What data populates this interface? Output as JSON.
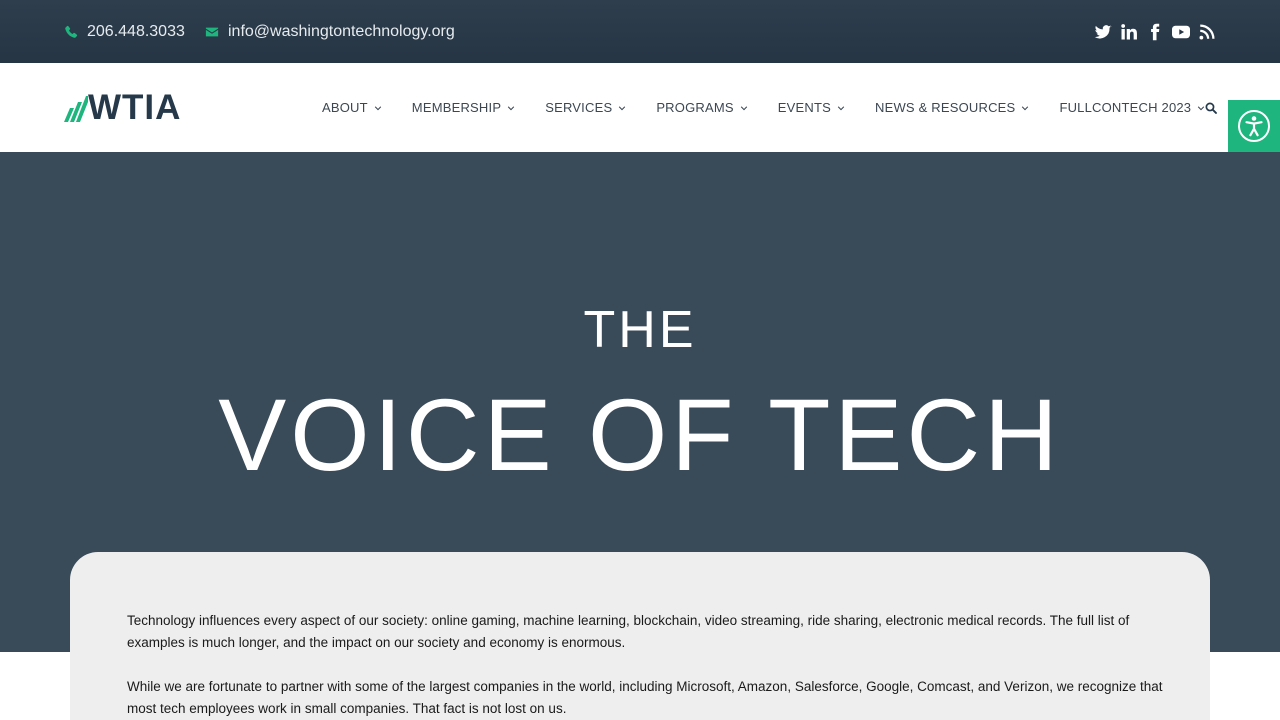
{
  "topbar": {
    "phone": "206.448.3033",
    "email": "info@washingtontechnology.org",
    "social": [
      "twitter-icon",
      "linkedin-icon",
      "facebook-icon",
      "youtube-icon",
      "rss-icon"
    ]
  },
  "header": {
    "logo_text": "WTIA",
    "nav": [
      {
        "label": "ABOUT"
      },
      {
        "label": "MEMBERSHIP"
      },
      {
        "label": "SERVICES"
      },
      {
        "label": "PROGRAMS"
      },
      {
        "label": "EVENTS"
      },
      {
        "label": "NEWS & RESOURCES"
      },
      {
        "label": "FULLCONTECH 2023"
      }
    ]
  },
  "hero": {
    "line1": "THE",
    "line2": "VOICE OF TECH"
  },
  "content": {
    "paragraph1": "Technology influences every aspect of our society: online gaming, machine learning, blockchain, video streaming, ride sharing, electronic medical records. The full list of examples is much longer, and the impact on our society and economy is enormous.",
    "paragraph2": "While we are fortunate to partner with some of the largest companies in the world, including Microsoft, Amazon, Salesforce, Google, Comcast, and Verizon, we recognize that most tech employees work in small companies. That fact is not lost on us."
  },
  "colors": {
    "topbar": "#2a3a49",
    "accent": "#1fb57e",
    "hero": "#394a59",
    "card": "#eeeeee"
  }
}
